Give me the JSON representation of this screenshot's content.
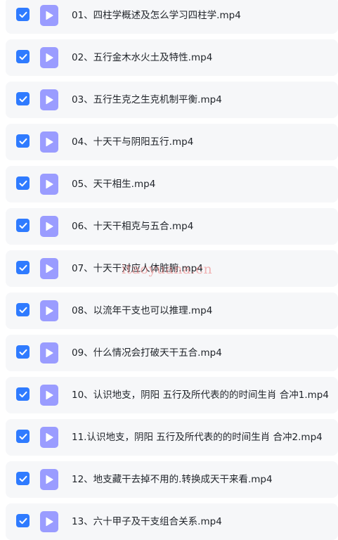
{
  "colors": {
    "row_background": "#f6f7f9",
    "checkbox": "#2f7bff",
    "file_icon": "#9a9cff",
    "text": "#1f2329"
  },
  "icons": {
    "checkbox": "check-icon",
    "file": "video-file-icon"
  },
  "files": [
    {
      "name": "01、四柱学概述及怎么学习四柱学.mp4",
      "checked": true
    },
    {
      "name": "02、五行金木水火土及特性.mp4",
      "checked": true
    },
    {
      "name": "03、五行生克之生克机制平衡.mp4",
      "checked": true
    },
    {
      "name": "04、十天干与阴阳五行.mp4",
      "checked": true
    },
    {
      "name": "05、天干相生.mp4",
      "checked": true
    },
    {
      "name": "06、十天干相克与五合.mp4",
      "checked": true
    },
    {
      "name": "07、十天干对应人体脏腑.mp4",
      "checked": true
    },
    {
      "name": "08、以流年干支也可以推理.mp4",
      "checked": true
    },
    {
      "name": "09、什么情况会打破天干五合.mp4",
      "checked": true
    },
    {
      "name": "10、认识地支，阴阳 五行及所代表的的时间生肖 合冲1.mp4",
      "checked": true
    },
    {
      "name": "11.认识地支，阴阳 五行及所代表的的时间生肖 合冲2.mp4",
      "checked": true
    },
    {
      "name": "12、地支藏干去掉不用的.转换成天干来看.mp4",
      "checked": true
    },
    {
      "name": "13、六十甲子及干支组合关系.mp4",
      "checked": true
    }
  ],
  "watermark": "itaoyuana.cn"
}
